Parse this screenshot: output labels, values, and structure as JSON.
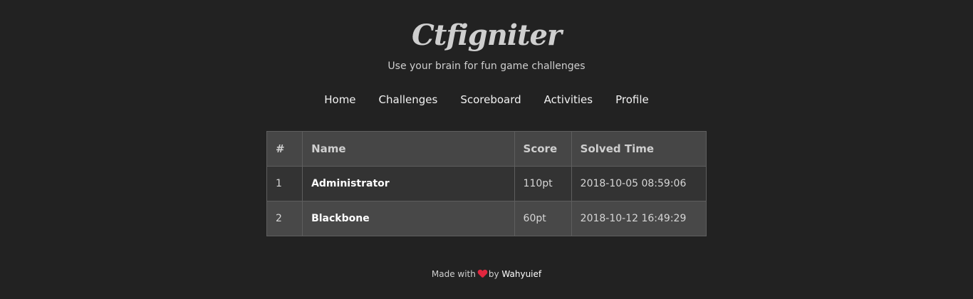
{
  "header": {
    "brand": "Ctfigniter",
    "tagline": "Use your brain for fun game challenges"
  },
  "nav": {
    "items": [
      {
        "label": "Home"
      },
      {
        "label": "Challenges"
      },
      {
        "label": "Scoreboard"
      },
      {
        "label": "Activities"
      },
      {
        "label": "Profile"
      }
    ]
  },
  "scoreboard": {
    "columns": [
      "#",
      "Name",
      "Score",
      "Solved Time"
    ],
    "rows": [
      {
        "rank": "1",
        "name": "Administrator",
        "score": "110pt",
        "solved_time": "2018-10-05 08:59:06"
      },
      {
        "rank": "2",
        "name": "Blackbone",
        "score": "60pt",
        "solved_time": "2018-10-12 16:49:29"
      }
    ]
  },
  "footer": {
    "made_with": "Made with",
    "by": "by",
    "author": "Wahyuief"
  },
  "colors": {
    "background": "#222222",
    "heart": "#e0263e"
  }
}
